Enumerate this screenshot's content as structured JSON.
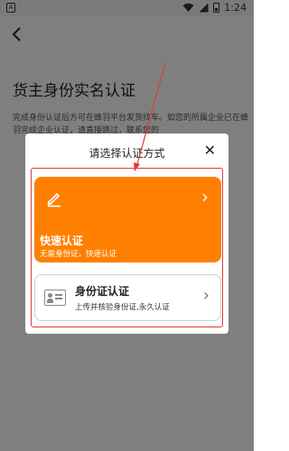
{
  "status_bar": {
    "time": "1:24",
    "left_icon": "A",
    "icons": [
      "wifi-icon",
      "signal-icon",
      "battery-icon"
    ]
  },
  "nav": {
    "back_icon": "‹"
  },
  "page": {
    "title": "货主身份实名认证",
    "description": "完成身份认证后方可在蜂羽平台发货找车。如您的所属企业已在蜂羽完成企业认证，请直接跳过，联系您的"
  },
  "dialog": {
    "title": "请选择认证方式",
    "close_icon": "✕",
    "options": {
      "fast": {
        "title": "快速认证",
        "subtitle": "无需身份证，快速认证",
        "arrow": "›",
        "color": "#ff8000"
      },
      "id_card": {
        "title": "身份证认证",
        "subtitle": "上传并核验身份证,永久认证",
        "arrow": "›"
      }
    }
  },
  "colors": {
    "accent": "#ff8000",
    "highlight": "#e53935"
  }
}
